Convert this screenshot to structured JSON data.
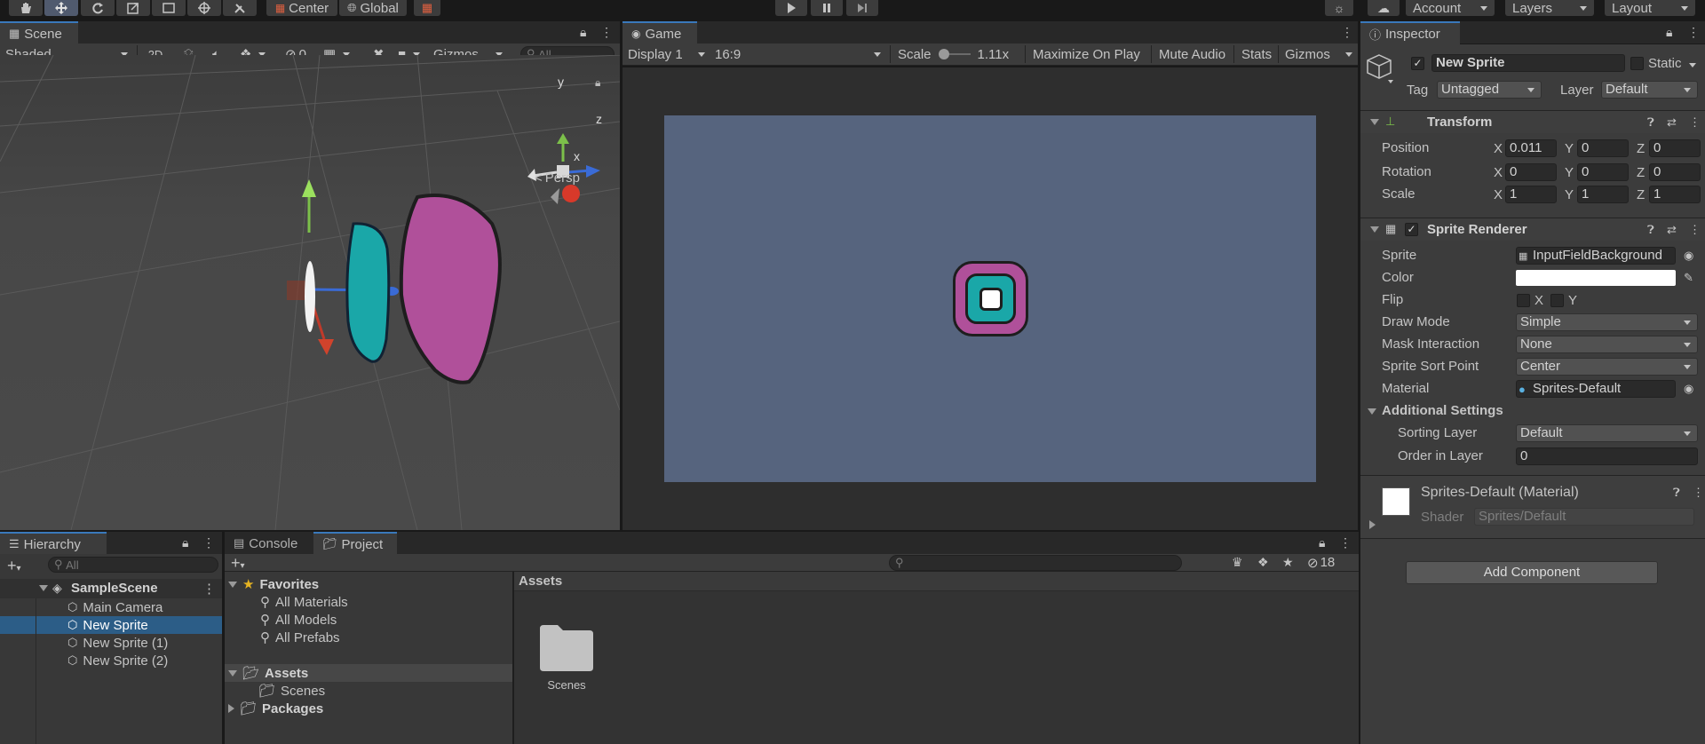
{
  "toolbar": {
    "pivot_label": "Center",
    "space_label": "Global",
    "account_label": "Account",
    "layers_label": "Layers",
    "layout_label": "Layout"
  },
  "scene": {
    "tab_label": "Scene",
    "shading_mode": "Shaded",
    "mode_2d_label": "2D",
    "hidden_count": "0",
    "gizmos_label": "Gizmos",
    "search_placeholder": "All",
    "gizmo_axes": {
      "y": "y",
      "z": "z",
      "x": "x"
    },
    "projection_label": "Persp"
  },
  "game": {
    "tab_label": "Game",
    "display_label": "Display 1",
    "aspect_label": "16:9",
    "scale_label": "Scale",
    "scale_value": "1.11x",
    "maximize_label": "Maximize On Play",
    "mute_label": "Mute Audio",
    "stats_label": "Stats",
    "gizmos_label": "Gizmos"
  },
  "inspector": {
    "tab_label": "Inspector",
    "object_name": "New Sprite",
    "static_label": "Static",
    "tag_label": "Tag",
    "tag_value": "Untagged",
    "layer_label": "Layer",
    "layer_value": "Default",
    "transform": {
      "title": "Transform",
      "position_label": "Position",
      "rotation_label": "Rotation",
      "scale_label": "Scale",
      "axis_x": "X",
      "axis_y": "Y",
      "axis_z": "Z",
      "position": {
        "x": "0.011",
        "y": "0",
        "z": "0"
      },
      "rotation": {
        "x": "0",
        "y": "0",
        "z": "0"
      },
      "scale": {
        "x": "1",
        "y": "1",
        "z": "1"
      }
    },
    "sprite_renderer": {
      "title": "Sprite Renderer",
      "sprite_label": "Sprite",
      "sprite_value": "InputFieldBackground",
      "color_label": "Color",
      "color_value": "#ffffff",
      "flip_label": "Flip",
      "flip_x": "X",
      "flip_y": "Y",
      "draw_mode_label": "Draw Mode",
      "draw_mode_value": "Simple",
      "mask_label": "Mask Interaction",
      "mask_value": "None",
      "sort_point_label": "Sprite Sort Point",
      "sort_point_value": "Center",
      "material_label": "Material",
      "material_value": "Sprites-Default",
      "additional_label": "Additional Settings",
      "sorting_layer_label": "Sorting Layer",
      "sorting_layer_value": "Default",
      "order_label": "Order in Layer",
      "order_value": "0"
    },
    "material": {
      "title": "Sprites-Default (Material)",
      "shader_label": "Shader",
      "shader_value": "Sprites/Default"
    },
    "add_component_label": "Add Component"
  },
  "hierarchy": {
    "tab_label": "Hierarchy",
    "search_placeholder": "All",
    "scene_name": "SampleScene",
    "items": [
      "Main Camera",
      "New Sprite",
      "New Sprite (1)",
      "New Sprite (2)"
    ]
  },
  "console": {
    "tab_label": "Console"
  },
  "project": {
    "tab_label": "Project",
    "hidden_count": "18",
    "favorites_label": "Favorites",
    "favorites": [
      "All Materials",
      "All Models",
      "All Prefabs"
    ],
    "assets_label": "Assets",
    "asset_folders": [
      "Scenes"
    ],
    "packages_label": "Packages",
    "breadcrumb": "Assets",
    "grid_items": [
      "Scenes"
    ]
  },
  "colors": {
    "accent": "#3a79bb",
    "selection": "#2c5d87",
    "game_bg": "#56647e",
    "sprite_magenta": "#b0509a",
    "sprite_teal": "#1aa7a8"
  }
}
